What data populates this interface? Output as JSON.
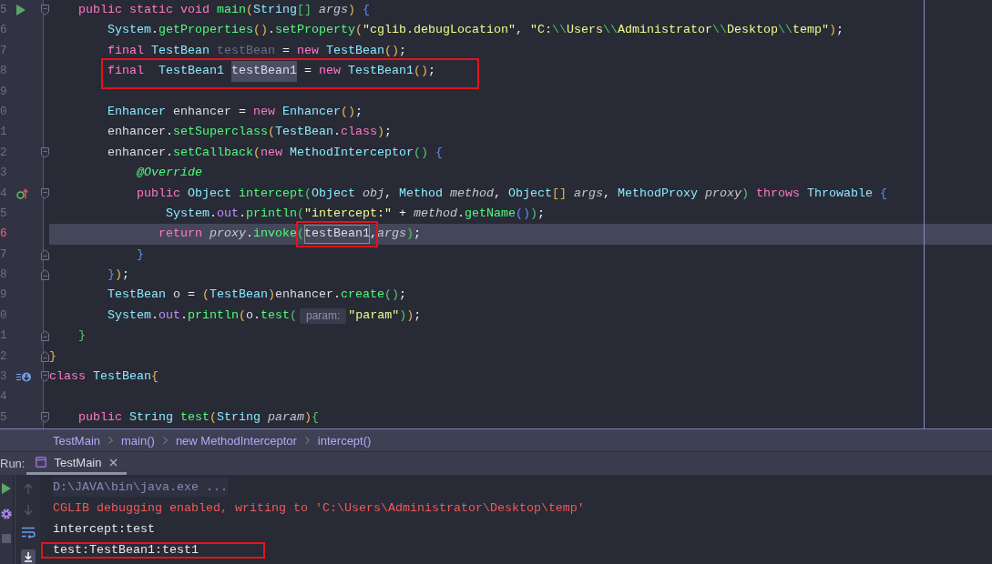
{
  "code_lines": [
    {
      "number": "5",
      "current": false,
      "boxed": false,
      "gutter_icon": {
        "kind": "run"
      },
      "fold": {
        "kind": "start"
      },
      "tokens": [
        {
          "text": "    public ",
          "kind": "keyword"
        },
        {
          "text": "static ",
          "kind": "keyword"
        },
        {
          "text": "void ",
          "kind": "keyword"
        },
        {
          "text": "main",
          "kind": "method"
        },
        {
          "text": "(",
          "kind": "bracket_a"
        },
        {
          "text": "String",
          "kind": "type"
        },
        {
          "text": "[] ",
          "kind": "bracket_b"
        },
        {
          "text": "args",
          "kind": "param"
        },
        {
          "text": ") ",
          "kind": "bracket_a"
        },
        {
          "text": "{",
          "kind": "bracket_c"
        }
      ]
    },
    {
      "number": "6",
      "current": false,
      "boxed": false,
      "tokens": [
        {
          "text": "        System",
          "kind": "type"
        },
        {
          "text": ".",
          "kind": "plain"
        },
        {
          "text": "getProperties",
          "kind": "method"
        },
        {
          "text": "()",
          "kind": "bracket_a"
        },
        {
          "text": ".",
          "kind": "plain"
        },
        {
          "text": "setProperty",
          "kind": "method"
        },
        {
          "text": "(",
          "kind": "bracket_a"
        },
        {
          "text": "\"cglib.debugLocation\"",
          "kind": "string"
        },
        {
          "text": ", ",
          "kind": "plain"
        },
        {
          "text": "\"C:",
          "kind": "string"
        },
        {
          "text": "\\\\",
          "kind": "escape"
        },
        {
          "text": "Users",
          "kind": "string"
        },
        {
          "text": "\\\\",
          "kind": "escape"
        },
        {
          "text": "Administrator",
          "kind": "string"
        },
        {
          "text": "\\\\",
          "kind": "escape"
        },
        {
          "text": "Desktop",
          "kind": "string"
        },
        {
          "text": "\\\\",
          "kind": "escape"
        },
        {
          "text": "temp\"",
          "kind": "string"
        },
        {
          "text": ")",
          "kind": "bracket_a"
        },
        {
          "text": ";",
          "kind": "plain"
        }
      ]
    },
    {
      "number": "7",
      "current": false,
      "boxed": false,
      "tokens": [
        {
          "text": "        final ",
          "kind": "keyword"
        },
        {
          "text": "TestBean ",
          "kind": "type"
        },
        {
          "text": "testBean ",
          "kind": "unused"
        },
        {
          "text": "= ",
          "kind": "plain"
        },
        {
          "text": "new ",
          "kind": "keyword"
        },
        {
          "text": "TestBean",
          "kind": "type"
        },
        {
          "text": "()",
          "kind": "bracket_a"
        },
        {
          "text": ";",
          "kind": "plain"
        }
      ]
    },
    {
      "number": "8",
      "current": false,
      "boxed": true,
      "tokens": [
        {
          "text": "        final  ",
          "kind": "keyword"
        },
        {
          "text": "TestBean1 ",
          "kind": "type"
        },
        {
          "text": "testBean1",
          "kind": "local",
          "highlight": {
            "kind": "write"
          }
        },
        {
          "text": " = ",
          "kind": "plain"
        },
        {
          "text": "new ",
          "kind": "keyword"
        },
        {
          "text": "TestBean1",
          "kind": "type"
        },
        {
          "text": "()",
          "kind": "bracket_a"
        },
        {
          "text": ";",
          "kind": "plain"
        }
      ]
    },
    {
      "number": "9",
      "current": false,
      "boxed": false
    },
    {
      "number": "0",
      "current": false,
      "boxed": false,
      "tokens": [
        {
          "text": "        Enhancer ",
          "kind": "type"
        },
        {
          "text": "enhancer ",
          "kind": "local"
        },
        {
          "text": "= ",
          "kind": "plain"
        },
        {
          "text": "new ",
          "kind": "keyword"
        },
        {
          "text": "Enhancer",
          "kind": "type"
        },
        {
          "text": "()",
          "kind": "bracket_a"
        },
        {
          "text": ";",
          "kind": "plain"
        }
      ]
    },
    {
      "number": "1",
      "current": false,
      "boxed": false,
      "tokens": [
        {
          "text": "        enhancer",
          "kind": "local"
        },
        {
          "text": ".",
          "kind": "plain"
        },
        {
          "text": "setSuperclass",
          "kind": "method"
        },
        {
          "text": "(",
          "kind": "bracket_a"
        },
        {
          "text": "TestBean",
          "kind": "type"
        },
        {
          "text": ".",
          "kind": "plain"
        },
        {
          "text": "class",
          "kind": "keyword"
        },
        {
          "text": ")",
          "kind": "bracket_a"
        },
        {
          "text": ";",
          "kind": "plain"
        }
      ]
    },
    {
      "number": "2",
      "current": false,
      "boxed": false,
      "fold": {
        "kind": "start"
      },
      "tokens": [
        {
          "text": "        enhancer",
          "kind": "local"
        },
        {
          "text": ".",
          "kind": "plain"
        },
        {
          "text": "setCallback",
          "kind": "method"
        },
        {
          "text": "(",
          "kind": "bracket_a"
        },
        {
          "text": "new ",
          "kind": "keyword"
        },
        {
          "text": "MethodInterceptor",
          "kind": "type"
        },
        {
          "text": "() ",
          "kind": "bracket_b"
        },
        {
          "text": "{",
          "kind": "bracket_c"
        }
      ]
    },
    {
      "number": "3",
      "current": false,
      "boxed": false,
      "tokens": [
        {
          "text": "            @Override",
          "kind": "annotation"
        }
      ]
    },
    {
      "number": "4",
      "current": false,
      "boxed": false,
      "gutter_icon": {
        "kind": "implements"
      },
      "fold": {
        "kind": "start"
      },
      "tokens": [
        {
          "text": "            public ",
          "kind": "keyword"
        },
        {
          "text": "Object ",
          "kind": "type"
        },
        {
          "text": "intercept",
          "kind": "method"
        },
        {
          "text": "(",
          "kind": "bracket_b"
        },
        {
          "text": "Object ",
          "kind": "type"
        },
        {
          "text": "obj",
          "kind": "param"
        },
        {
          "text": ", ",
          "kind": "plain"
        },
        {
          "text": "Method ",
          "kind": "type"
        },
        {
          "text": "method",
          "kind": "param"
        },
        {
          "text": ", ",
          "kind": "plain"
        },
        {
          "text": "Object",
          "kind": "type"
        },
        {
          "text": "[] ",
          "kind": "bracket_a"
        },
        {
          "text": "args",
          "kind": "param"
        },
        {
          "text": ", ",
          "kind": "plain"
        },
        {
          "text": "MethodProxy ",
          "kind": "type"
        },
        {
          "text": "proxy",
          "kind": "param"
        },
        {
          "text": ") ",
          "kind": "bracket_b"
        },
        {
          "text": "throws ",
          "kind": "keyword"
        },
        {
          "text": "Throwable ",
          "kind": "type"
        },
        {
          "text": "{",
          "kind": "bracket_c"
        }
      ]
    },
    {
      "number": "5",
      "current": false,
      "boxed": false,
      "tokens": [
        {
          "text": "                System",
          "kind": "type"
        },
        {
          "text": ".",
          "kind": "plain"
        },
        {
          "text": "out",
          "kind": "field"
        },
        {
          "text": ".",
          "kind": "plain"
        },
        {
          "text": "println",
          "kind": "method"
        },
        {
          "text": "(",
          "kind": "bracket_b"
        },
        {
          "text": "\"intercept:\"",
          "kind": "string"
        },
        {
          "text": " + ",
          "kind": "plain"
        },
        {
          "text": "method",
          "kind": "param"
        },
        {
          "text": ".",
          "kind": "plain"
        },
        {
          "text": "getName",
          "kind": "method"
        },
        {
          "text": "()",
          "kind": "bracket_c"
        },
        {
          "text": ")",
          "kind": "bracket_b"
        },
        {
          "text": ";",
          "kind": "plain"
        }
      ]
    },
    {
      "number": "6",
      "current": true,
      "boxed": false,
      "tokens": [
        {
          "text": "               return ",
          "kind": "keyword"
        },
        {
          "text": "proxy",
          "kind": "param"
        },
        {
          "text": ".",
          "kind": "plain"
        },
        {
          "text": "invoke",
          "kind": "method"
        },
        {
          "text": "(",
          "kind": "bracket_b"
        },
        {
          "text": "testBean1",
          "kind": "local",
          "highlight": {
            "kind": "read"
          },
          "boxed": true
        },
        {
          "text": ",",
          "kind": "plain"
        },
        {
          "text": "args",
          "kind": "param"
        },
        {
          "text": ")",
          "kind": "bracket_b"
        },
        {
          "text": ";",
          "kind": "plain"
        }
      ]
    },
    {
      "number": "7",
      "current": false,
      "boxed": false,
      "fold": {
        "kind": "end"
      },
      "tokens": [
        {
          "text": "            }",
          "kind": "bracket_c"
        }
      ]
    },
    {
      "number": "8",
      "current": false,
      "boxed": false,
      "fold": {
        "kind": "end"
      },
      "tokens": [
        {
          "text": "        }",
          "kind": "bracket_c"
        },
        {
          "text": ")",
          "kind": "bracket_a"
        },
        {
          "text": ";",
          "kind": "plain"
        }
      ]
    },
    {
      "number": "9",
      "current": false,
      "boxed": false,
      "tokens": [
        {
          "text": "        TestBean ",
          "kind": "type"
        },
        {
          "text": "o ",
          "kind": "local"
        },
        {
          "text": "= ",
          "kind": "plain"
        },
        {
          "text": "(",
          "kind": "bracket_a"
        },
        {
          "text": "TestBean",
          "kind": "type"
        },
        {
          "text": ")",
          "kind": "bracket_a"
        },
        {
          "text": "enhancer",
          "kind": "local"
        },
        {
          "text": ".",
          "kind": "plain"
        },
        {
          "text": "create",
          "kind": "method"
        },
        {
          "text": "()",
          "kind": "bracket_b"
        },
        {
          "text": ";",
          "kind": "plain"
        }
      ]
    },
    {
      "number": "0",
      "current": false,
      "boxed": false,
      "tokens": [
        {
          "text": "        System",
          "kind": "type"
        },
        {
          "text": ".",
          "kind": "plain"
        },
        {
          "text": "out",
          "kind": "field"
        },
        {
          "text": ".",
          "kind": "plain"
        },
        {
          "text": "println",
          "kind": "method"
        },
        {
          "text": "(",
          "kind": "bracket_a"
        },
        {
          "text": "o",
          "kind": "local"
        },
        {
          "text": ".",
          "kind": "plain"
        },
        {
          "text": "test",
          "kind": "method"
        },
        {
          "text": "(",
          "kind": "bracket_b"
        },
        {
          "text": "param:",
          "kind": "hint"
        },
        {
          "text": "\"param\"",
          "kind": "string"
        },
        {
          "text": ")",
          "kind": "bracket_b"
        },
        {
          "text": ")",
          "kind": "bracket_a"
        },
        {
          "text": ";",
          "kind": "plain"
        }
      ]
    },
    {
      "number": "1",
      "current": false,
      "boxed": false,
      "fold": {
        "kind": "end"
      },
      "tokens": [
        {
          "text": "    }",
          "kind": "bracket_b"
        }
      ]
    },
    {
      "number": "2",
      "current": false,
      "boxed": false,
      "fold": {
        "kind": "end"
      },
      "tokens": [
        {
          "text": "}",
          "kind": "bracket_a"
        }
      ]
    },
    {
      "number": "3",
      "current": false,
      "boxed": false,
      "gutter_icon": {
        "kind": "subclassed"
      },
      "fold": {
        "kind": "start"
      },
      "tokens": [
        {
          "text": "class ",
          "kind": "keyword"
        },
        {
          "text": "TestBean",
          "kind": "type"
        },
        {
          "text": "{",
          "kind": "bracket_a"
        }
      ]
    },
    {
      "number": "4",
      "current": false,
      "boxed": false
    },
    {
      "number": "5",
      "current": false,
      "boxed": false,
      "fold": {
        "kind": "start"
      },
      "tokens": [
        {
          "text": "    public ",
          "kind": "keyword"
        },
        {
          "text": "String ",
          "kind": "type"
        },
        {
          "text": "test",
          "kind": "method"
        },
        {
          "text": "(",
          "kind": "bracket_a"
        },
        {
          "text": "String ",
          "kind": "type"
        },
        {
          "text": "param",
          "kind": "param"
        },
        {
          "text": ")",
          "kind": "bracket_a"
        },
        {
          "text": "{",
          "kind": "bracket_b"
        }
      ]
    }
  ],
  "breadcrumbs": [
    "TestMain",
    "main()",
    "new MethodInterceptor",
    "intercept()"
  ],
  "run_window": {
    "label": "Run:",
    "tabs": [
      {
        "title": "TestMain",
        "selected": true
      }
    ],
    "side_toolbar": [
      {
        "kind": "rerun",
        "disabled": false
      },
      {
        "kind": "settings",
        "disabled": false
      },
      {
        "kind": "stop",
        "disabled": true
      }
    ],
    "console_toolbar": [
      {
        "kind": "up",
        "disabled": true,
        "on": false
      },
      {
        "kind": "down",
        "disabled": true,
        "on": false
      },
      {
        "kind": "soft_wrap",
        "disabled": false,
        "on": false
      },
      {
        "kind": "scroll_to_end",
        "disabled": false,
        "on": true
      }
    ],
    "console_lines": [
      {
        "text": "D:\\JAVA\\bin\\java.exe ...",
        "kind": "command",
        "boxed": false
      },
      {
        "text": "CGLIB debugging enabled, writing to 'C:\\Users\\Administrator\\Desktop\\temp'",
        "kind": "error",
        "boxed": false
      },
      {
        "text": "intercept:test",
        "kind": "output",
        "boxed": false
      },
      {
        "text": "test:TestBean1:test1",
        "kind": "output",
        "boxed": true
      }
    ]
  }
}
